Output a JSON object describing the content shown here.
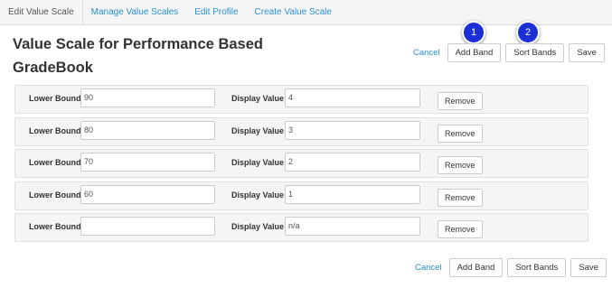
{
  "tabs": [
    {
      "label": "Edit Value Scale",
      "active": true
    },
    {
      "label": "Manage Value Scales",
      "active": false
    },
    {
      "label": "Edit Profile",
      "active": false
    },
    {
      "label": "Create Value Scale",
      "active": false
    }
  ],
  "page_title": "Value Scale for Performance Based GradeBook",
  "actions": {
    "cancel_label": "Cancel",
    "add_band_label": "Add Band",
    "sort_bands_label": "Sort Bands",
    "save_label": "Save"
  },
  "badges": {
    "first": "1",
    "second": "2"
  },
  "bands": {
    "lower_bound_label": "Lower Bound",
    "display_value_label": "Display Value",
    "remove_label": "Remove",
    "rows": [
      {
        "lower_bound": "90",
        "display_value": "4"
      },
      {
        "lower_bound": "80",
        "display_value": "3"
      },
      {
        "lower_bound": "70",
        "display_value": "2"
      },
      {
        "lower_bound": "60",
        "display_value": "1"
      },
      {
        "lower_bound": "",
        "display_value": "n/a"
      }
    ]
  },
  "colors": {
    "link": "#2a8fd0",
    "badge": "#1b2fd8",
    "row_background": "#f5f5f5"
  }
}
